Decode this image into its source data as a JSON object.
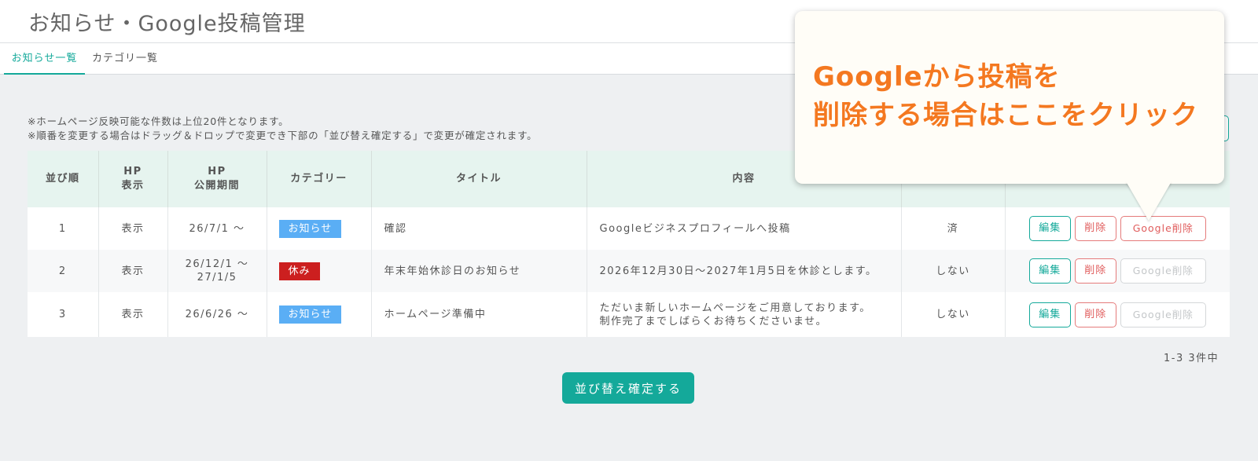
{
  "page": {
    "title": "お知らせ・Google投稿管理"
  },
  "tabs": [
    {
      "label": "お知らせ一覧",
      "active": true
    },
    {
      "label": "カテゴリ一覧",
      "active": false
    }
  ],
  "notes": [
    "※ホームページ反映可能な件数は上位20件となります。",
    "※順番を変更する場合はドラッグ＆ドロップで変更でき下部の「並び替え確定する」で変更が確定されます。"
  ],
  "table": {
    "headers": {
      "order": "並び順",
      "hp_display_1": "HP",
      "hp_display_2": "表示",
      "hp_period_1": "HP",
      "hp_period_2": "公開期間",
      "category": "カテゴリー",
      "title": "タイトル",
      "content": "内容"
    },
    "rows": [
      {
        "order": "1",
        "display": "表示",
        "period_1": "26/7/1 〜",
        "period_2": "",
        "category": "お知らせ",
        "category_color": "#5aaef5",
        "title": "確認",
        "content_1": "Googleビジネスプロフィールへ投稿",
        "content_2": "",
        "google_status": "済",
        "edit_label": "編集",
        "delete_label": "削除",
        "google_delete_label": "Google削除",
        "google_delete_enabled": true
      },
      {
        "order": "2",
        "display": "表示",
        "period_1": "26/12/1 〜",
        "period_2": "27/1/5",
        "category": "休み",
        "category_color": "#cc1f1f",
        "title": "年末年始休診日のお知らせ",
        "content_1": "2026年12月30日〜2027年1月5日を休診とします。",
        "content_2": "",
        "google_status": "しない",
        "edit_label": "編集",
        "delete_label": "削除",
        "google_delete_label": "Google削除",
        "google_delete_enabled": false
      },
      {
        "order": "3",
        "display": "表示",
        "period_1": "26/6/26 〜",
        "period_2": "",
        "category": "お知らせ",
        "category_color": "#5aaef5",
        "title": "ホームページ準備中",
        "content_1": "ただいま新しいホームページをご用意しております。",
        "content_2": "制作完了までしばらくお待ちくださいませ。",
        "google_status": "しない",
        "edit_label": "編集",
        "delete_label": "削除",
        "google_delete_label": "Google削除",
        "google_delete_enabled": false
      }
    ]
  },
  "pagination": {
    "count_text": "1-3  3件中"
  },
  "confirm_button": {
    "label": "並び替え確定する"
  },
  "callout": {
    "line_1": "Googleから投稿を",
    "line_2": "削除する場合はここをクリック"
  },
  "colors": {
    "accent": "#14a99a",
    "danger": "#e05c5c",
    "callout_text": "#f47820",
    "header_bg": "#e6f4ef"
  }
}
